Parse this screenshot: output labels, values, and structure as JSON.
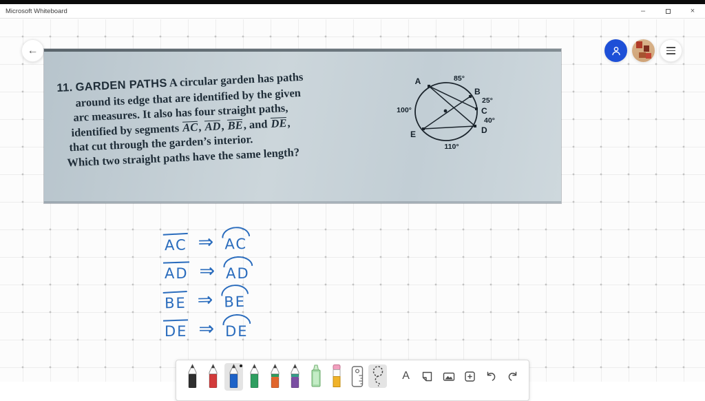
{
  "window": {
    "title": "Microsoft Whiteboard",
    "minimize_glyph": "–",
    "close_glyph": "×"
  },
  "nav": {
    "back_glyph": "←"
  },
  "problem": {
    "number": "11.",
    "title": "GARDEN PATHS",
    "line1": "A circular garden has paths",
    "line2": "around its edge that are identified by the given",
    "line3": "arc measures. It also has four straight paths,",
    "line4": {
      "prefix": "identified by segments ",
      "seg1": "AC",
      "sep1": ", ",
      "seg2": "AD",
      "sep2": ", ",
      "seg3": "BE",
      "sep3": ", and ",
      "seg4": "DE",
      "end": ","
    },
    "line5": "that cut through the garden’s interior.",
    "line6": "Which two straight paths have the same length?"
  },
  "diagram": {
    "labels": {
      "a": "A",
      "b": "B",
      "c": "C",
      "d": "D",
      "e": "E"
    },
    "arc_labels": {
      "ab": "85°",
      "bc": "25°",
      "cd": "40°",
      "de": "110°",
      "ea": "100°"
    },
    "chords": [
      "AC",
      "AD",
      "BE",
      "ED"
    ]
  },
  "ink": {
    "color": "#2a6cbd",
    "rows": [
      {
        "segment": "AC",
        "arrow": "⇒",
        "arc": "AC"
      },
      {
        "segment": "AD",
        "arrow": "⇒",
        "arc": "AD"
      },
      {
        "segment": "BE",
        "arrow": "⇒",
        "arc": "BE"
      },
      {
        "segment": "DE",
        "arrow": "⇒",
        "arc": "DE"
      }
    ]
  },
  "toolbar": {
    "pens": [
      {
        "id": "black",
        "color": "#2f2f2f"
      },
      {
        "id": "red",
        "color": "#d23b3b"
      },
      {
        "id": "blue",
        "color": "#1e63c8",
        "selected": true
      },
      {
        "id": "green",
        "color": "#2f9e60"
      },
      {
        "id": "orange",
        "color": "#e0662d",
        "collar": "#2f9e60"
      },
      {
        "id": "purple",
        "color": "#7b4fa3",
        "collar": "#36a089"
      }
    ],
    "text_tool_label": "A"
  },
  "colors": {
    "accent_blue": "#1d4fd7",
    "ink_blue": "#2a6cbd"
  }
}
